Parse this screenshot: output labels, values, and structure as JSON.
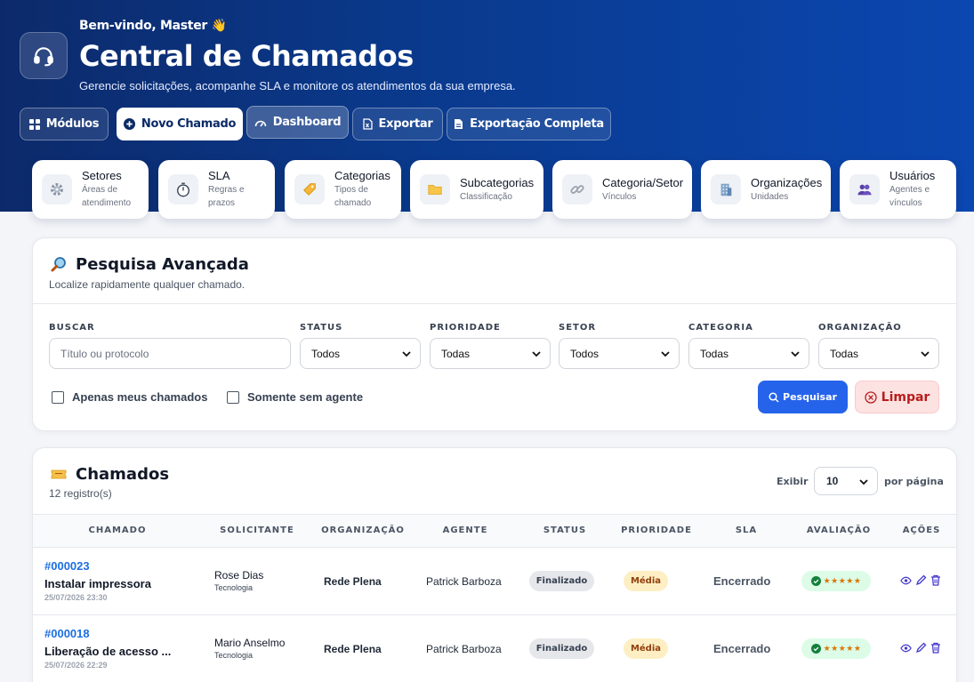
{
  "header": {
    "welcome": "Bem-vindo, Master 👋",
    "title": "Central de Chamados",
    "subtitle": "Gerencie solicitações, acompanhe SLA e monitore os atendimentos da sua empresa.",
    "buttons": {
      "modules": "Módulos",
      "new_ticket": "Novo Chamado",
      "dashboard": "Dashboard",
      "export": "Exportar",
      "full_export": "Exportação Completa"
    }
  },
  "shortcuts": [
    {
      "name": "Setores",
      "desc1": "Áreas de",
      "desc2": "atendimento",
      "icon": "gear-icon"
    },
    {
      "name": "SLA",
      "desc1": "Regras e",
      "desc2": "prazos",
      "icon": "stopwatch-icon"
    },
    {
      "name": "Categorias",
      "desc1": "Tipos de",
      "desc2": "chamado",
      "icon": "tag-icon"
    },
    {
      "name": "Subcategorias",
      "desc1": "Classificação",
      "desc2": "",
      "icon": "folder-icon"
    },
    {
      "name": "Categoria/Setor",
      "desc1": "Vínculos",
      "desc2": "",
      "icon": "link-icon"
    },
    {
      "name": "Organizações",
      "desc1": "Unidades",
      "desc2": "",
      "icon": "building-icon"
    },
    {
      "name": "Usuários",
      "desc1": "Agentes e",
      "desc2": "vínculos",
      "icon": "users-icon"
    }
  ],
  "search": {
    "title": "Pesquisa Avançada",
    "subtitle": "Localize rapidamente qualquer chamado.",
    "labels": {
      "search": "BUSCAR",
      "status": "STATUS",
      "priority": "PRIORIDADE",
      "sector": "SETOR",
      "category": "CATEGORIA",
      "organization": "ORGANIZAÇÃO"
    },
    "placeholder": "Título ou protocolo",
    "values": {
      "status": "Todos",
      "priority": "Todas",
      "sector": "Todos",
      "category": "Todas",
      "organization": "Todas"
    },
    "only_mine": "Apenas meus chamados",
    "no_agent": "Somente sem agente",
    "search_button": "Pesquisar",
    "clear_button": "Limpar"
  },
  "tickets": {
    "title": "Chamados",
    "count": "12 registro(s)",
    "show_label": "Exibir",
    "per_page_value": "10",
    "per_page_label": "por página",
    "columns": [
      "CHAMADO",
      "SOLICITANTE",
      "ORGANIZAÇÃO",
      "AGENTE",
      "STATUS",
      "PRIORIDADE",
      "SLA",
      "AVALIAÇÃO",
      "AÇÕES"
    ],
    "rows": [
      {
        "id": "#000023",
        "subject": "Instalar impressora",
        "date": "25/07/2026 23:30",
        "requester": "Rose Dias",
        "requester_dept": "Tecnologia",
        "organization": "Rede Plena",
        "agent": "Patrick Barboza",
        "status": "Finalizado",
        "priority": "Média",
        "sla": "Encerrado",
        "rating": "★★★★★"
      },
      {
        "id": "#000018",
        "subject": "Liberação de acesso ...",
        "date": "25/07/2026 22:29",
        "requester": "Mario Anselmo",
        "requester_dept": "Tecnologia",
        "organization": "Rede Plena",
        "agent": "Patrick Barboza",
        "status": "Finalizado",
        "priority": "Média",
        "sla": "Encerrado",
        "rating": "★★★★★"
      }
    ]
  },
  "colors": {
    "hero_start": "#0c2a6b",
    "hero_end": "#0b47b0",
    "primary": "#2563eb",
    "link": "#1d6fe0",
    "danger_bg": "#fde2e2",
    "danger_text": "#b91c1c",
    "status_bg": "#e5e7eb",
    "priority_bg": "#fdefc3",
    "rating_bg": "#dcfce7"
  }
}
